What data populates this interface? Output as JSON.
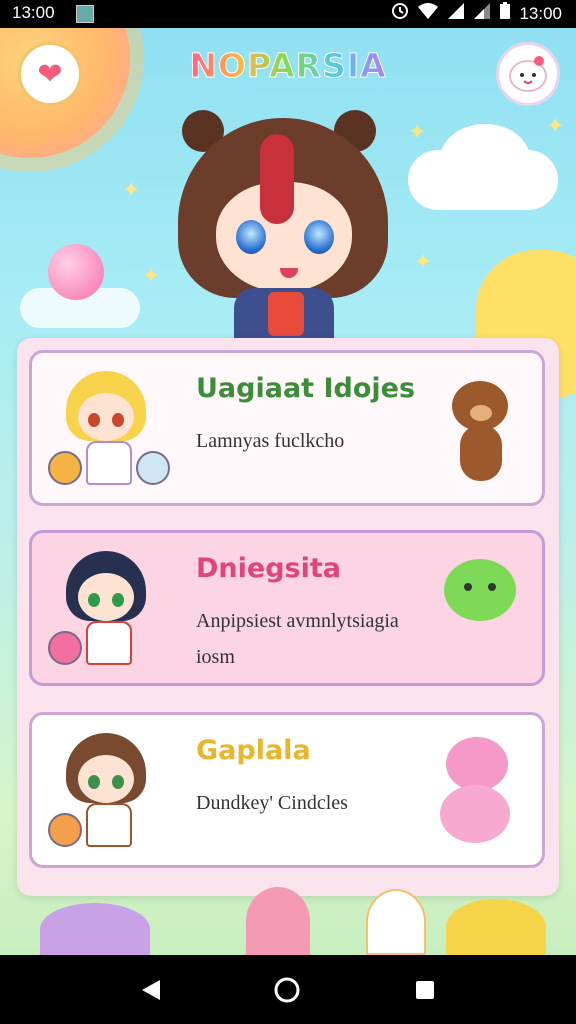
{
  "status_bar": {
    "time_left": "13:00",
    "time_right": "13:00"
  },
  "header": {
    "logo_text": "NOPARSIA"
  },
  "cards": [
    {
      "title": "Uagiaat Idojes",
      "subtitle": "Lamnyas fuclkcho",
      "title_color": "#3d8c3a"
    },
    {
      "title": "Dniegsita",
      "subtitle": "Anpipsiest avmnlytsiagia iosm",
      "title_color": "#e0457a"
    },
    {
      "title": "Gaplala",
      "subtitle": "Dundkey' Cindcles",
      "title_color": "#e8b52c"
    }
  ],
  "icons": {
    "left_top": "heart-icon",
    "right_top": "mascot-face-icon",
    "nav_back": "back-icon",
    "nav_home": "home-icon",
    "nav_recent": "recent-apps-icon"
  }
}
